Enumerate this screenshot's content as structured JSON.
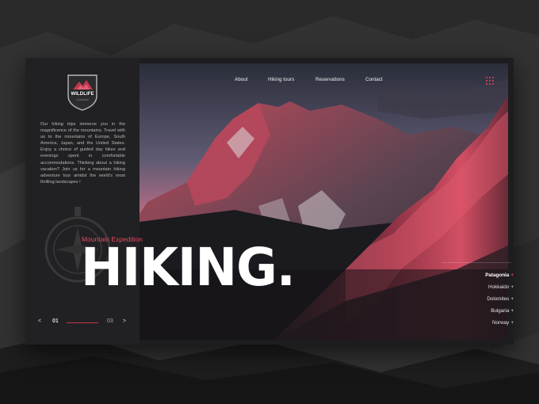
{
  "brand": {
    "logo_text": "WILDLIFE",
    "logo_sub": "OUTDOOR"
  },
  "nav": {
    "items": [
      "About",
      "Hiking tours",
      "Reservations",
      "Contact"
    ]
  },
  "intro_text": "Our hiking trips immerse you in the magnificence of the mountains. Travel with us to the mountains of Europe, South America, Japan, and the United States. Enjoy a choice of guided day hikes and evenings spent in comfortable accommodations. Thinking about a hiking vacation? Join us for a mountain hiking adventure tour amidst the world's most thrilling landscapes !",
  "hero": {
    "subtitle": "Mountain Expedition",
    "title": "HIKING."
  },
  "pager": {
    "prev": "<",
    "current": "01",
    "total": "03",
    "next": ">"
  },
  "destinations": [
    {
      "name": "Patagonia",
      "plus": "+",
      "active": true
    },
    {
      "name": "Hokkaido",
      "plus": "+",
      "active": false
    },
    {
      "name": "Dolomites",
      "plus": "+",
      "active": false
    },
    {
      "name": "Bulgaria",
      "plus": "+",
      "active": false
    },
    {
      "name": "Norway",
      "plus": "+",
      "active": false
    }
  ],
  "icons": {
    "menu": "grid-menu-icon",
    "logo": "wildlife-shield-logo",
    "decor": "compass-icon"
  },
  "colors": {
    "accent": "#e4475d",
    "panel": "#212123",
    "text": "#f1f1f1"
  }
}
